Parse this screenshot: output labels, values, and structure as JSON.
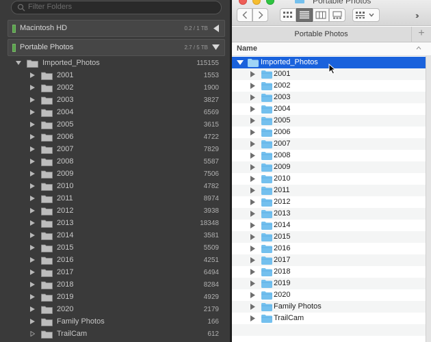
{
  "lightroom": {
    "filter_placeholder": "Filter Folders",
    "volumes": [
      {
        "name": "Macintosh HD",
        "size": "0.2 / 1 TB",
        "expanded": false
      },
      {
        "name": "Portable Photos",
        "size": "2.7 / 5 TB",
        "expanded": true
      }
    ],
    "parent": {
      "label": "Imported_Photos",
      "count": "115155"
    },
    "folders": [
      {
        "label": "2001",
        "count": "1553"
      },
      {
        "label": "2002",
        "count": "1900"
      },
      {
        "label": "2003",
        "count": "3827"
      },
      {
        "label": "2004",
        "count": "6569"
      },
      {
        "label": "2005",
        "count": "3615"
      },
      {
        "label": "2006",
        "count": "4722"
      },
      {
        "label": "2007",
        "count": "7829"
      },
      {
        "label": "2008",
        "count": "5587"
      },
      {
        "label": "2009",
        "count": "7506"
      },
      {
        "label": "2010",
        "count": "4782"
      },
      {
        "label": "2011",
        "count": "8974"
      },
      {
        "label": "2012",
        "count": "3938"
      },
      {
        "label": "2013",
        "count": "18348"
      },
      {
        "label": "2014",
        "count": "3581"
      },
      {
        "label": "2015",
        "count": "5509"
      },
      {
        "label": "2016",
        "count": "4251"
      },
      {
        "label": "2017",
        "count": "6494"
      },
      {
        "label": "2018",
        "count": "8284"
      },
      {
        "label": "2019",
        "count": "4929"
      },
      {
        "label": "2020",
        "count": "2179"
      },
      {
        "label": "Family Photos",
        "count": "166"
      },
      {
        "label": "TrailCam",
        "count": "612"
      }
    ]
  },
  "finder": {
    "window_title": "Portable Photos",
    "tab_label": "Portable Photos",
    "column_header": "Name",
    "selected_folder": "Imported_Photos",
    "folders": [
      "2001",
      "2002",
      "2003",
      "2004",
      "2005",
      "2006",
      "2007",
      "2008",
      "2009",
      "2010",
      "2011",
      "2012",
      "2013",
      "2014",
      "2015",
      "2016",
      "2017",
      "2018",
      "2019",
      "2020",
      "Family Photos",
      "TrailCam"
    ]
  },
  "colors": {
    "lr_bg": "#3a3a3a",
    "lr_text": "#c8c8c8",
    "finder_selection": "#1a62dc",
    "finder_folder": "#74c0ee",
    "status_green": "#57a44a"
  }
}
